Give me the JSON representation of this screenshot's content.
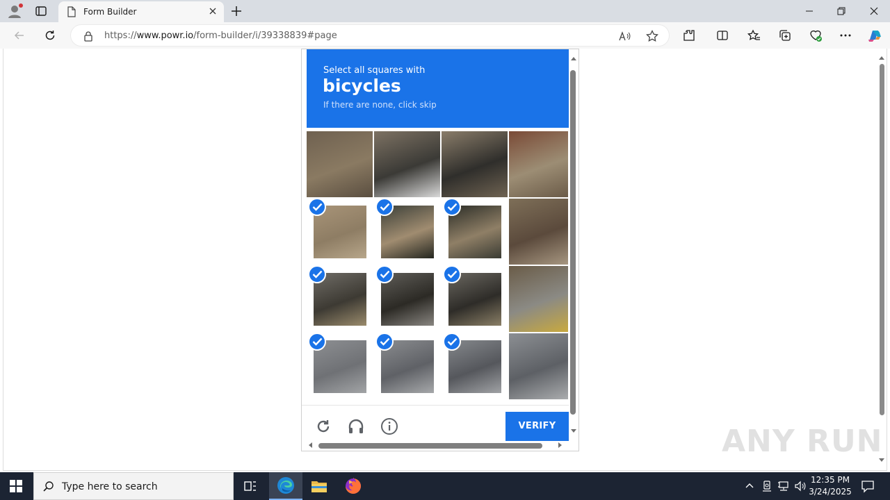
{
  "browser": {
    "tab_title": "Form Builder",
    "url_prefix": "https://",
    "url_host": "www.powr.io",
    "url_path": "/form-builder/i/39338839#page"
  },
  "captcha": {
    "prompt": "Select all squares with",
    "object": "bicycles",
    "hint": "If there are none, click skip",
    "verify_label": "VERIFY",
    "accent": "#1a73e8",
    "tiles": [
      {
        "row": 0,
        "col": 0,
        "selected": false
      },
      {
        "row": 0,
        "col": 1,
        "selected": false
      },
      {
        "row": 0,
        "col": 2,
        "selected": false
      },
      {
        "row": 0,
        "col": 3,
        "selected": false
      },
      {
        "row": 1,
        "col": 0,
        "selected": true
      },
      {
        "row": 1,
        "col": 1,
        "selected": true
      },
      {
        "row": 1,
        "col": 2,
        "selected": true
      },
      {
        "row": 1,
        "col": 3,
        "selected": false
      },
      {
        "row": 2,
        "col": 0,
        "selected": true
      },
      {
        "row": 2,
        "col": 1,
        "selected": true
      },
      {
        "row": 2,
        "col": 2,
        "selected": true
      },
      {
        "row": 2,
        "col": 3,
        "selected": false
      },
      {
        "row": 3,
        "col": 0,
        "selected": true
      },
      {
        "row": 3,
        "col": 1,
        "selected": true
      },
      {
        "row": 3,
        "col": 2,
        "selected": true
      },
      {
        "row": 3,
        "col": 3,
        "selected": false
      }
    ],
    "footer_icons": [
      "reload-icon",
      "audio-icon",
      "info-icon"
    ]
  },
  "watermark": "ANY RUN",
  "taskbar": {
    "search_placeholder": "Type here to search",
    "time": "12:35 PM",
    "date": "3/24/2025"
  }
}
